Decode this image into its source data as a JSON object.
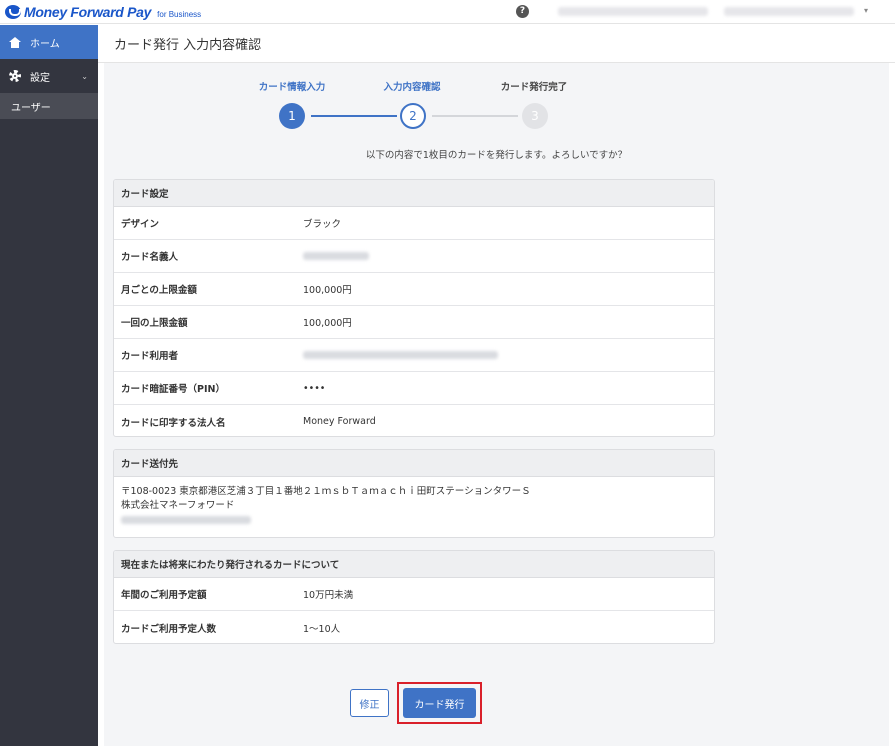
{
  "header": {
    "logo_text": "Money Forward Pay",
    "logo_sub": "for Business",
    "help_symbol": "?"
  },
  "sidebar": {
    "items": [
      {
        "label": "ホーム",
        "icon": "home-icon"
      },
      {
        "label": "設定",
        "icon": "gear-icon"
      },
      {
        "label": "ユーザー"
      }
    ]
  },
  "page": {
    "title": "カード発行 入力内容確認"
  },
  "stepper": {
    "steps": [
      {
        "label": "カード情報入力",
        "number": "1",
        "state": "done"
      },
      {
        "label": "入力内容確認",
        "number": "2",
        "state": "active"
      },
      {
        "label": "カード発行完了",
        "number": "3",
        "state": "todo"
      }
    ]
  },
  "confirm_message": "以下の内容で1枚目のカードを発行します。よろしいですか？",
  "card_settings": {
    "heading": "カード設定",
    "rows": [
      {
        "label": "デザイン",
        "value": "ブラック"
      },
      {
        "label": "カード名義人",
        "value": ""
      },
      {
        "label": "月ごとの上限金額",
        "value": "100,000円"
      },
      {
        "label": "一回の上限金額",
        "value": "100,000円"
      },
      {
        "label": "カード利用者",
        "value": ""
      },
      {
        "label": "カード暗証番号（PIN）",
        "value": "••••"
      },
      {
        "label": "カードに印字する法人名",
        "value": "Money Forward"
      }
    ]
  },
  "shipping": {
    "heading": "カード送付先",
    "address_line": "〒108-0023 東京都港区芝浦３丁目１番地２１ｍｓｂＴａｍａｃｈｉ田町ステーションタワーＳ",
    "company_line": "株式会社マネーフォワード"
  },
  "usage": {
    "heading": "現在または将来にわたり発行されるカードについて",
    "rows": [
      {
        "label": "年間のご利用予定額",
        "value": "10万円未満"
      },
      {
        "label": "カードご利用予定人数",
        "value": "1〜10人"
      }
    ]
  },
  "buttons": {
    "edit_label": "修正",
    "issue_label": "カード発行"
  },
  "colors": {
    "primary": "#3f73c6",
    "sidebar": "#33353f",
    "highlight": "#d9202a"
  }
}
